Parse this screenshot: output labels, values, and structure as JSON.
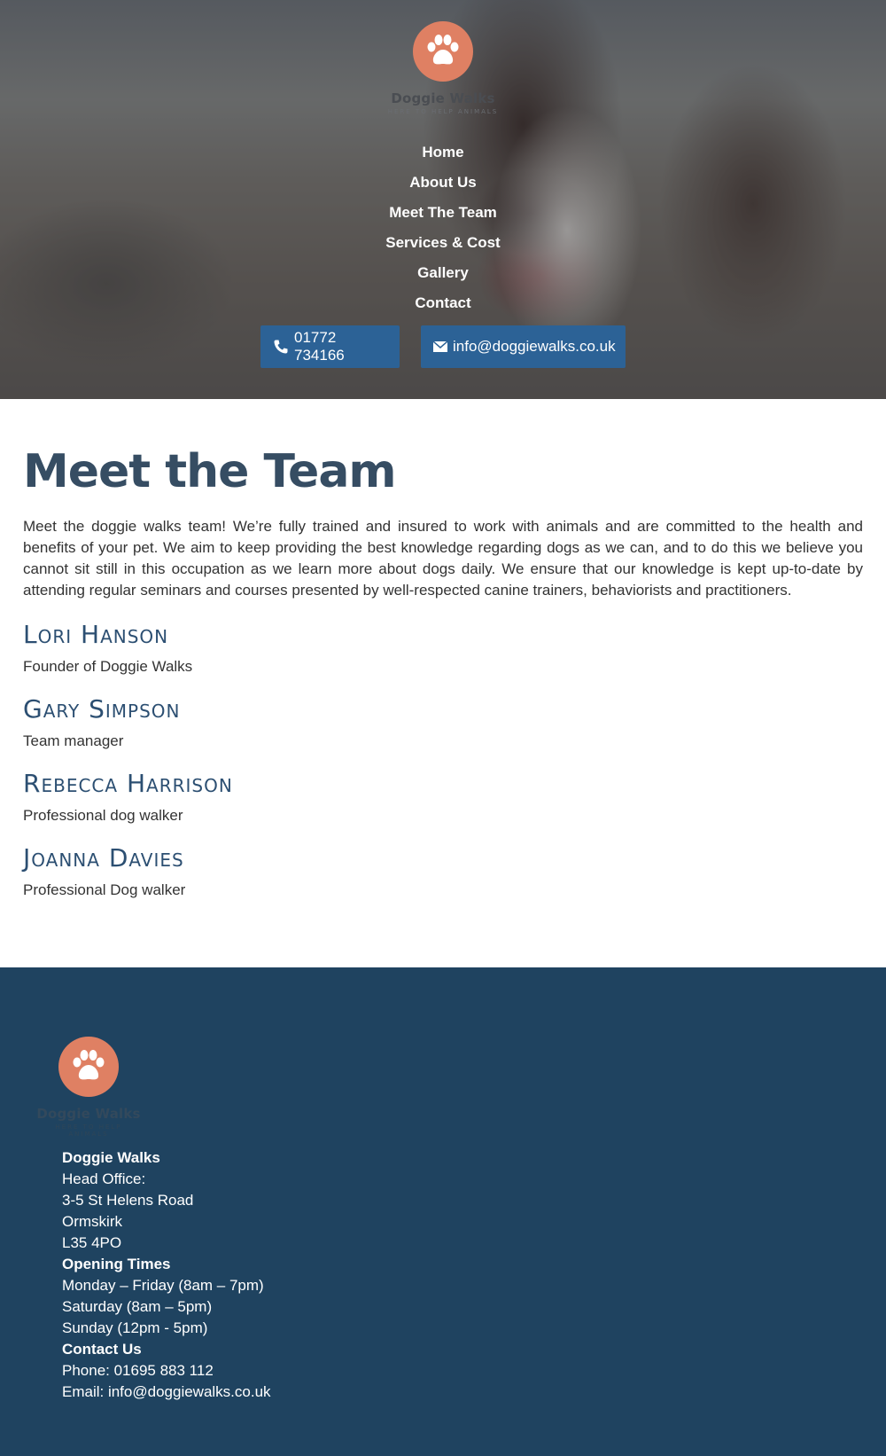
{
  "brand": {
    "name": "Doggie Walks",
    "tagline": "HERE TO HELP ANIMALS",
    "logo_color": "#df8063"
  },
  "nav": {
    "items": [
      {
        "label": "Home"
      },
      {
        "label": "About Us"
      },
      {
        "label": "Meet The Team"
      },
      {
        "label": "Services & Cost"
      },
      {
        "label": "Gallery"
      },
      {
        "label": "Contact"
      }
    ]
  },
  "cta": {
    "phone_label": "01772 734166",
    "phone_icon": "phone-icon",
    "email_label": "info@doggiewalks.co.uk",
    "email_icon": "envelope-icon",
    "color": "#2c6296"
  },
  "main": {
    "title": "Meet the Team",
    "intro": "Meet the doggie walks team! We’re fully trained and insured to work with animals and are committed to the health and benefits of your pet. We aim to keep providing the best knowledge regarding dogs as we can, and to do this we believe you cannot sit still in this occupation as we learn more about dogs daily. We ensure that our knowledge is kept up-to-date by attending regular seminars and courses presented by well-respected canine trainers, behaviorists and practitioners.",
    "team": [
      {
        "name": "Lori Hanson",
        "role": "Founder of Doggie Walks"
      },
      {
        "name": "Gary Simpson",
        "role": "Team manager"
      },
      {
        "name": "Rebecca Harrison",
        "role": "Professional dog walker"
      },
      {
        "name": "Joanna Davies",
        "role": "Professional Dog walker"
      }
    ]
  },
  "footer": {
    "company": "Doggie Walks",
    "office_label": "Head Office:",
    "address": [
      "3-5 St Helens Road",
      "Ormskirk",
      "L35 4PO"
    ],
    "hours_heading": "Opening Times",
    "hours": [
      "Monday – Friday (8am – 7pm)",
      "Saturday (8am – 5pm)",
      "Sunday (12pm - 5pm)"
    ],
    "contact_heading": "Contact Us",
    "phone": "Phone: 01695 883 112",
    "email": "Email: info@doggiewalks.co.uk",
    "bg_color": "#1f4360"
  }
}
